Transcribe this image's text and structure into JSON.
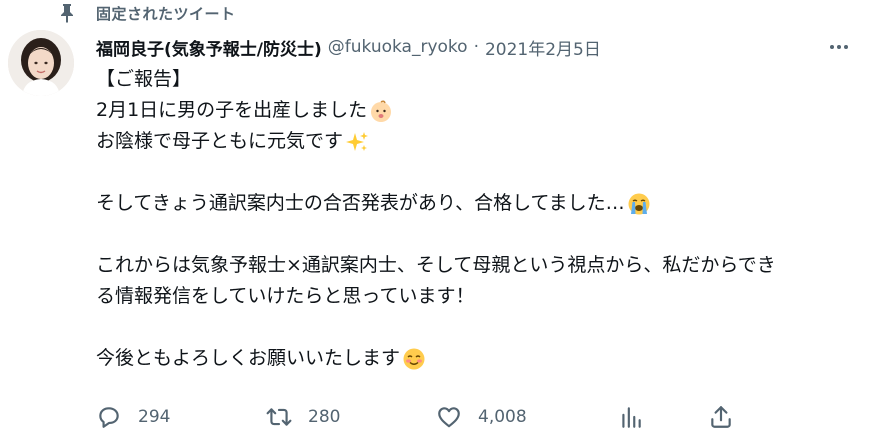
{
  "pinned": {
    "label": "固定されたツイート",
    "icon": "pin-icon"
  },
  "author": {
    "display_name": "福岡良子(気象予報士/防災士)",
    "handle": "@fukuoka_ryoko",
    "separator": "·",
    "date": "2021年2月5日"
  },
  "tweet": {
    "lines": [
      "【ご報告】",
      "2月1日に男の子を出産しました",
      "お陰様で母子ともに元気です",
      "",
      "そしてきょう通訳案内士の合否発表があり、合格してました…",
      "",
      "これからは気象予報士×通訳案内士、そして母親という視点から、私だからでき",
      "る情報発信をしていけたらと思っています！",
      "",
      "今後ともよろしくお願いいたします"
    ],
    "emojis": {
      "line2": "baby-emoji",
      "line3": "sparkles-emoji",
      "line5": "crying-face-emoji",
      "line10": "smiling-face-emoji"
    }
  },
  "actions": {
    "reply": {
      "icon": "reply-icon",
      "count": "294"
    },
    "retweet": {
      "icon": "retweet-icon",
      "count": "280"
    },
    "like": {
      "icon": "heart-icon",
      "count": "4,008"
    },
    "analytics": {
      "icon": "analytics-icon"
    },
    "share": {
      "icon": "share-icon"
    }
  },
  "colors": {
    "text_primary": "#0f1419",
    "text_secondary": "#536471",
    "background": "#ffffff"
  }
}
